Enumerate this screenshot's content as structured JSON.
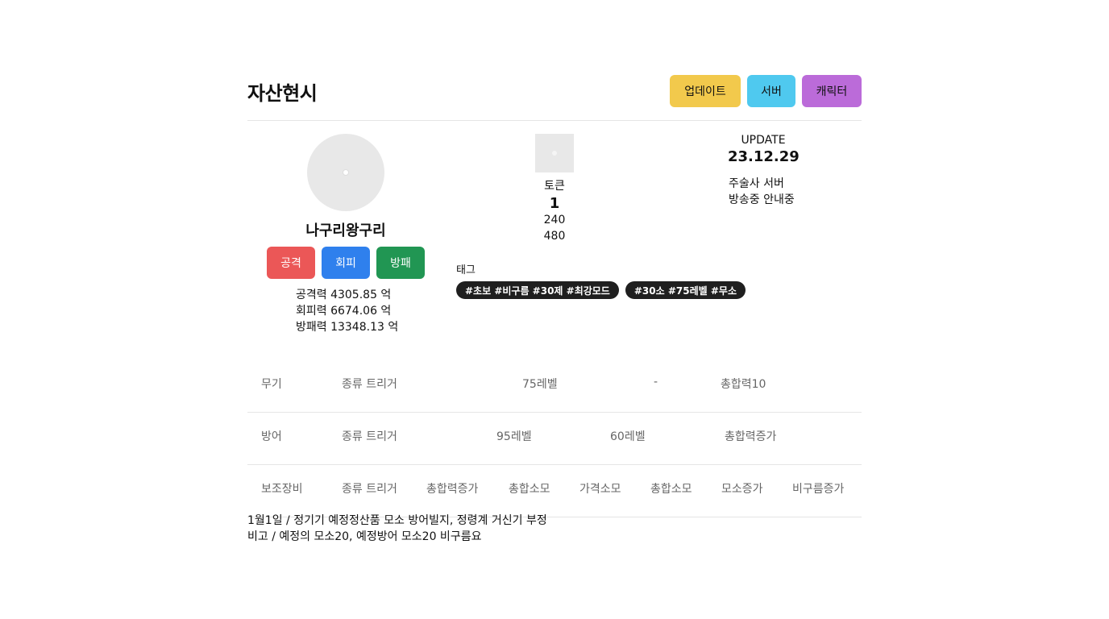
{
  "header": {
    "title": "자산현시",
    "buttons": {
      "update": "업데이트",
      "server": "서버",
      "character": "캐릭터"
    }
  },
  "profile": {
    "name": "나구리왕구리",
    "actions": {
      "attack": "공격",
      "evade": "회피",
      "defend": "방패"
    },
    "stats": [
      "공격력 4305.85 억",
      "회피력 6674.06 억",
      "방패력 13348.13 억"
    ]
  },
  "token": {
    "label": "토큰",
    "value": "1",
    "sub1": "240",
    "sub2": "480"
  },
  "update": {
    "label": "UPDATE",
    "date": "23.12.29",
    "note1": "주술사 서버",
    "note2": "방송중 안내중"
  },
  "tags": {
    "label": "태그",
    "items": [
      "#초보 #비구름 #30제 #최강모드",
      "#30소 #75레벨 #무소"
    ]
  },
  "rows": {
    "weapon": {
      "c0": "무기",
      "c1": "종류 트리거",
      "c2": "75레벨",
      "c3": "-",
      "c4": "총합력10"
    },
    "armor": {
      "c0": "방어",
      "c1": "종류 트리거",
      "c2": "95레벨",
      "c3": "60레벨",
      "c4": "총합력증가"
    },
    "sub": {
      "c0": "보조장비",
      "c1": "종류 트리거",
      "c2": "총합력증가",
      "c3": "총합소모",
      "c4": "가격소모",
      "c5": "총합소모",
      "c6": "모소증가",
      "c7": "비구름증가"
    }
  },
  "notes": {
    "line1": "1월1일 / 정기기 예정정산품 모소 방어빌지, 정령계 거신기 부정",
    "line2": "비고 / 예정의 모소20, 예정방어 모소20 비구름요"
  },
  "colors": {
    "update": "#f2c94c",
    "server": "#4fc9ef",
    "character": "#bb6bd9",
    "attack": "#eb5757",
    "evade": "#2f80ed",
    "defend": "#219653",
    "tag": "#1f1f1f"
  }
}
